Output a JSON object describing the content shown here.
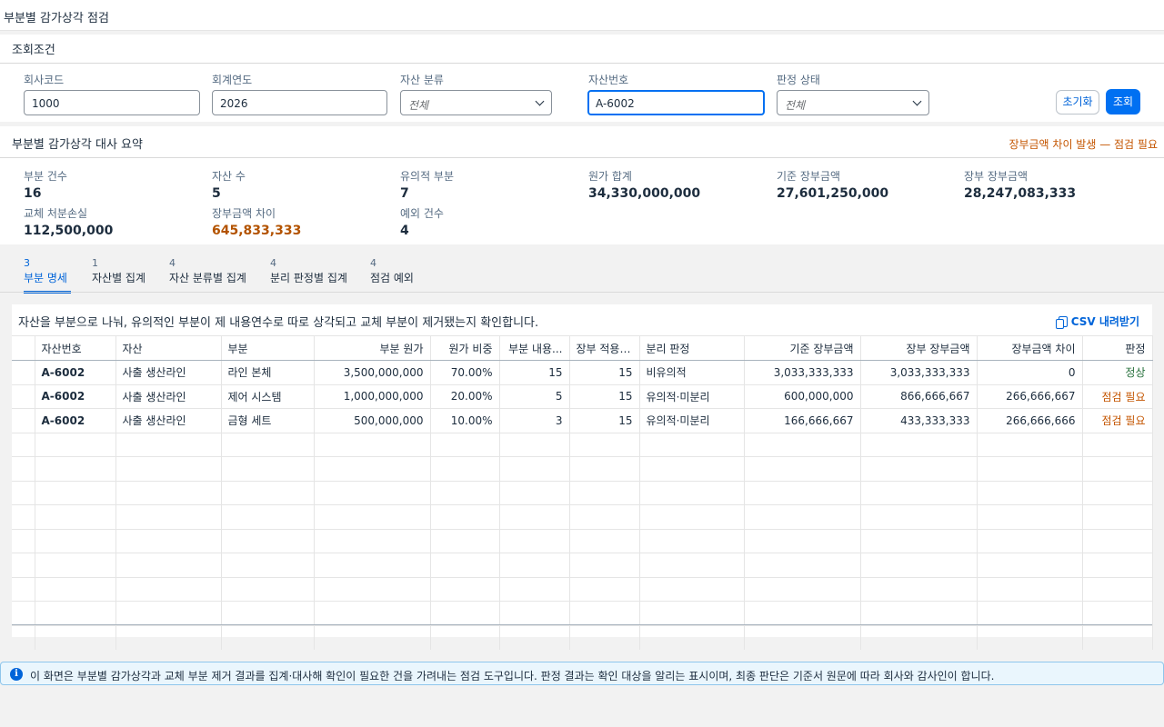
{
  "page": {
    "title": "부분별 감가상각 점검"
  },
  "filters": {
    "header": "조회조건",
    "company_code": {
      "label": "회사코드",
      "value": "1000"
    },
    "fiscal_year": {
      "label": "회계연도",
      "value": "2026"
    },
    "asset_class": {
      "label": "자산 분류",
      "value": "전체"
    },
    "asset_number": {
      "label": "자산번호",
      "value": "A-6002"
    },
    "judgment_status": {
      "label": "판정 상태",
      "value": "전체"
    },
    "reset_label": "초기화",
    "search_label": "조회"
  },
  "summary": {
    "header": "부분별 감가상각 대사 요약",
    "warning": "장부금액 차이 발생 — 점검 필요",
    "kpis": [
      {
        "label": "부분 건수",
        "value": "16"
      },
      {
        "label": "자산 수",
        "value": "5"
      },
      {
        "label": "유의적 부분",
        "value": "7"
      },
      {
        "label": "원가 합계",
        "value": "34,330,000,000"
      },
      {
        "label": "기준 장부금액",
        "value": "27,601,250,000"
      },
      {
        "label": "장부 장부금액",
        "value": "28,247,083,333"
      },
      {
        "label": "교체 처분손실",
        "value": "112,500,000"
      },
      {
        "label": "장부금액 차이",
        "value": "645,833,333"
      },
      {
        "label": "예외 건수",
        "value": "4"
      }
    ]
  },
  "tabs": [
    {
      "count": "3",
      "label": "부분 명세",
      "active": true
    },
    {
      "count": "1",
      "label": "자산별 집계"
    },
    {
      "count": "4",
      "label": "자산 분류별 집계"
    },
    {
      "count": "4",
      "label": "분리 판정별 집계"
    },
    {
      "count": "4",
      "label": "점검 예외"
    }
  ],
  "detail": {
    "description": "자산을 부분으로 나눠, 유의적인 부분이 제 내용연수로 따로 상각되고 교체 부분이 제거됐는지 확인합니다.",
    "csv_label": "CSV 내려받기",
    "columns": [
      "자산번호",
      "자산",
      "부분",
      "부분 원가",
      "원가 비중",
      "부분 내용...",
      "장부 적용 ...",
      "분리 판정",
      "기준 장부금액",
      "장부 장부금액",
      "장부금액 차이",
      "판정"
    ],
    "rows": [
      [
        "A-6002",
        "사출 생산라인",
        "라인 본체",
        "3,500,000,000",
        "70.00%",
        "15",
        "15",
        "비유의적",
        "3,033,333,333",
        "3,033,333,333",
        "0",
        "정상"
      ],
      [
        "A-6002",
        "사출 생산라인",
        "제어 시스템",
        "1,000,000,000",
        "20.00%",
        "5",
        "15",
        "유의적·미분리",
        "600,000,000",
        "866,666,667",
        "266,666,667",
        "점검 필요"
      ],
      [
        "A-6002",
        "사출 생산라인",
        "금형 세트",
        "500,000,000",
        "10.00%",
        "3",
        "15",
        "유의적·미분리",
        "166,666,667",
        "433,333,333",
        "266,666,666",
        "점검 필요"
      ]
    ]
  },
  "info": {
    "icon": "info-icon",
    "text": "이 화면은 부분별 감가상각과 교체 부분 제거 결과를 집계·대사해 확인이 필요한 건을 가려내는 점검 도구입니다. 판정 결과는 확인 대상을 알리는 표시이며, 최종 판단은 기준서 원문에 따라 회사와 감사인이 합니다."
  }
}
